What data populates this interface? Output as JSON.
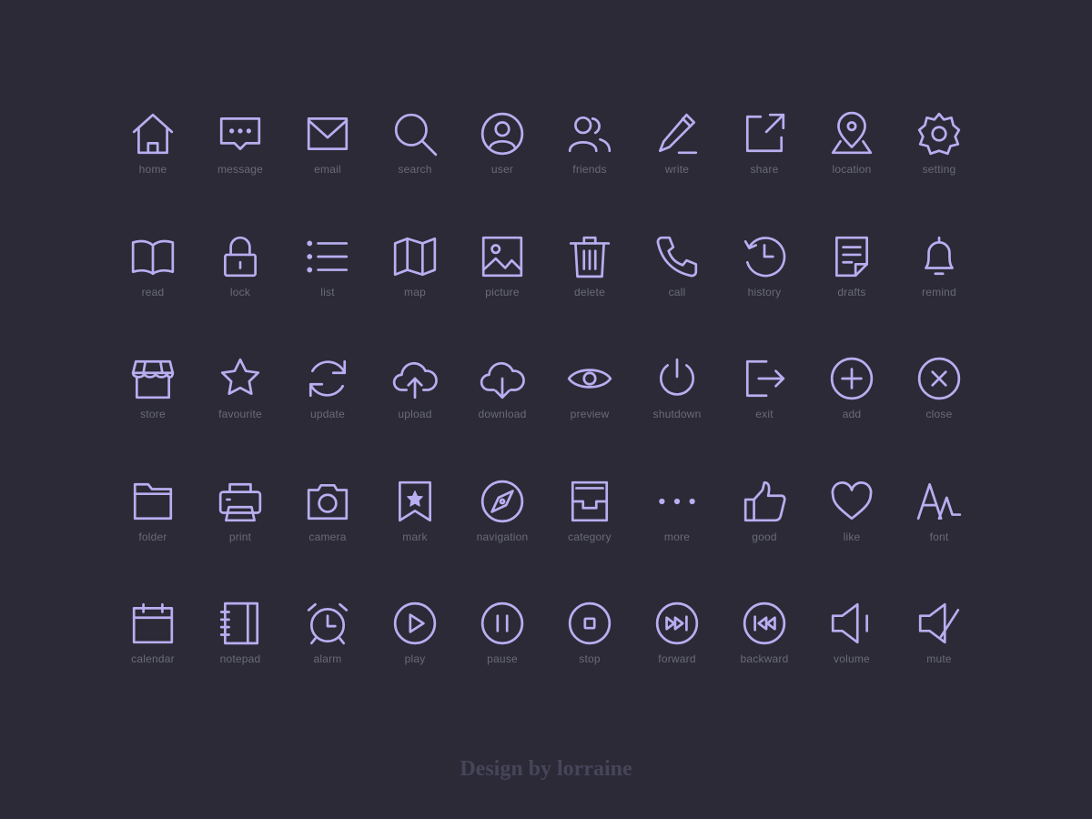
{
  "colors": {
    "background": "#2b2a36",
    "icon": "#b8aef0",
    "label": "#6b6a7a",
    "credit": "#46455a"
  },
  "rows": [
    [
      {
        "label": "home",
        "icon": "home-icon"
      },
      {
        "label": "message",
        "icon": "message-icon"
      },
      {
        "label": "email",
        "icon": "email-icon"
      },
      {
        "label": "search",
        "icon": "search-icon"
      },
      {
        "label": "user",
        "icon": "user-icon"
      },
      {
        "label": "friends",
        "icon": "friends-icon"
      },
      {
        "label": "write",
        "icon": "write-icon"
      },
      {
        "label": "share",
        "icon": "share-icon"
      },
      {
        "label": "location",
        "icon": "location-icon"
      },
      {
        "label": "setting",
        "icon": "setting-icon"
      }
    ],
    [
      {
        "label": "read",
        "icon": "read-icon"
      },
      {
        "label": "lock",
        "icon": "lock-icon"
      },
      {
        "label": "list",
        "icon": "list-icon"
      },
      {
        "label": "map",
        "icon": "map-icon"
      },
      {
        "label": "picture",
        "icon": "picture-icon"
      },
      {
        "label": "delete",
        "icon": "delete-icon"
      },
      {
        "label": "call",
        "icon": "call-icon"
      },
      {
        "label": "history",
        "icon": "history-icon"
      },
      {
        "label": "drafts",
        "icon": "drafts-icon"
      },
      {
        "label": "remind",
        "icon": "remind-icon"
      }
    ],
    [
      {
        "label": "store",
        "icon": "store-icon"
      },
      {
        "label": "favourite",
        "icon": "favourite-icon"
      },
      {
        "label": "update",
        "icon": "update-icon"
      },
      {
        "label": "upload",
        "icon": "upload-icon"
      },
      {
        "label": "download",
        "icon": "download-icon"
      },
      {
        "label": "preview",
        "icon": "preview-icon"
      },
      {
        "label": "shutdown",
        "icon": "shutdown-icon"
      },
      {
        "label": "exit",
        "icon": "exit-icon"
      },
      {
        "label": "add",
        "icon": "add-icon"
      },
      {
        "label": "close",
        "icon": "close-icon"
      }
    ],
    [
      {
        "label": "folder",
        "icon": "folder-icon"
      },
      {
        "label": "print",
        "icon": "print-icon"
      },
      {
        "label": "camera",
        "icon": "camera-icon"
      },
      {
        "label": "mark",
        "icon": "mark-icon"
      },
      {
        "label": "navigation",
        "icon": "navigation-icon"
      },
      {
        "label": "category",
        "icon": "category-icon"
      },
      {
        "label": "more",
        "icon": "more-icon"
      },
      {
        "label": "good",
        "icon": "good-icon"
      },
      {
        "label": "like",
        "icon": "like-icon"
      },
      {
        "label": "font",
        "icon": "font-icon"
      }
    ],
    [
      {
        "label": "calendar",
        "icon": "calendar-icon"
      },
      {
        "label": "notepad",
        "icon": "notepad-icon"
      },
      {
        "label": "alarm",
        "icon": "alarm-icon"
      },
      {
        "label": "play",
        "icon": "play-icon"
      },
      {
        "label": "pause",
        "icon": "pause-icon"
      },
      {
        "label": "stop",
        "icon": "stop-icon"
      },
      {
        "label": "forward",
        "icon": "forward-icon"
      },
      {
        "label": "backward",
        "icon": "backward-icon"
      },
      {
        "label": "volume",
        "icon": "volume-icon"
      },
      {
        "label": "mute",
        "icon": "mute-icon"
      }
    ]
  ],
  "footer": {
    "credit": "Design by lorraine"
  }
}
